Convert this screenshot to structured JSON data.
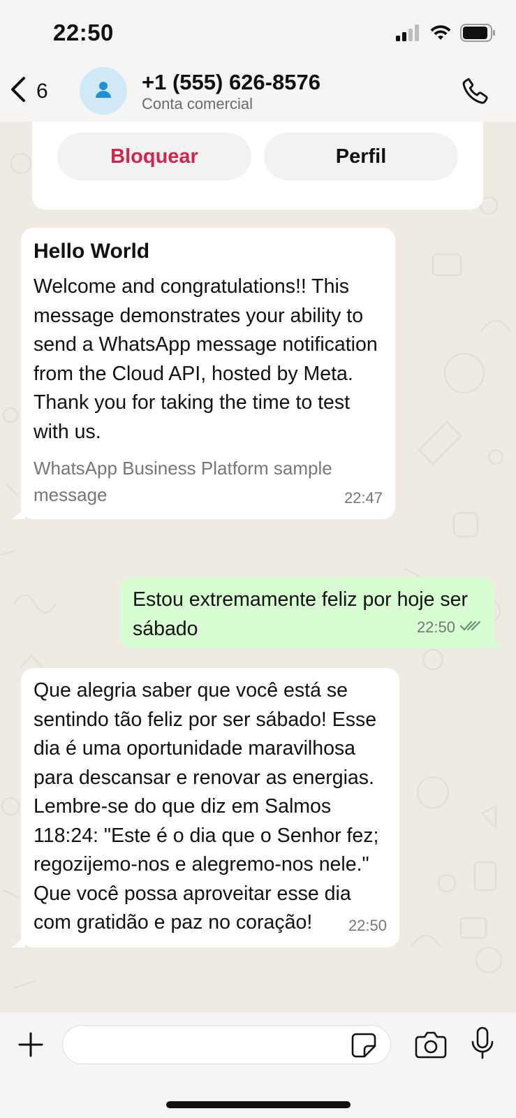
{
  "status": {
    "time": "22:50"
  },
  "header": {
    "back_count": "6",
    "contact_name": "+1 (555) 626-8576",
    "contact_subtitle": "Conta comercial"
  },
  "business_card": {
    "block_label": "Bloquear",
    "profile_label": "Perfil"
  },
  "messages": [
    {
      "direction": "incoming",
      "title": "Hello World",
      "text": "Welcome and congratulations!! This message demonstrates your ability to send a WhatsApp message notification from the Cloud API, hosted by Meta. Thank you for taking the time to test with us.",
      "footer": "WhatsApp Business Platform sample message",
      "time": "22:47"
    },
    {
      "direction": "outgoing",
      "text": "Estou extremamente feliz por hoje ser sábado",
      "time": "22:50",
      "status": "read"
    },
    {
      "direction": "incoming",
      "text": "Que alegria saber que você está se sentindo tão feliz por ser sábado! Esse dia é uma oportunidade maravilhosa para descansar e renovar as energias. Lembre-se do que diz em Salmos 118:24: \"Este é o dia que o Senhor fez; regozijemo-nos e alegremo-nos nele.\" Que você possa aproveitar esse dia com gratidão e paz no coração!",
      "time": "22:50"
    }
  ],
  "composer": {
    "input_value": ""
  },
  "colors": {
    "accent_block": "#d1244e",
    "outgoing_bubble": "#d9fdd3",
    "incoming_bubble": "#ffffff",
    "read_ticks": "#53bdeb"
  }
}
